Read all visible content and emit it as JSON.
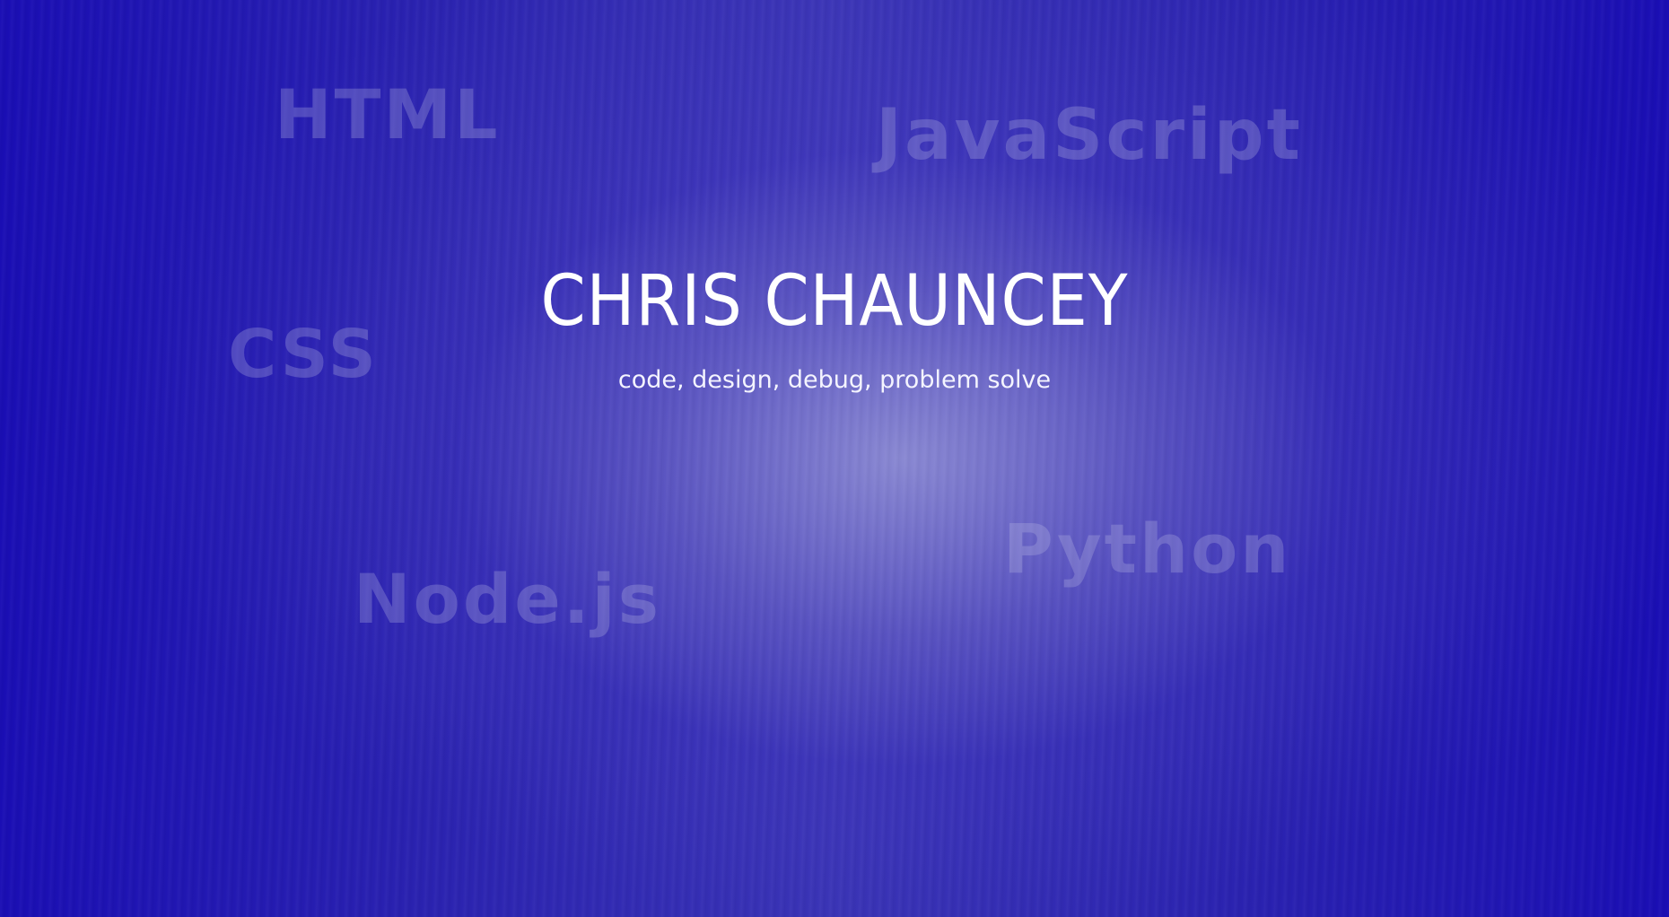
{
  "hero": {
    "name": "CHRIS CHAUNCEY",
    "tagline": "code, design, debug, problem solve"
  },
  "background_words": {
    "html": "HTML",
    "javascript": "JavaScript",
    "css": "CSS",
    "nodejs": "Node.js",
    "python": "Python"
  },
  "colors": {
    "background": "#1a10b0",
    "text": "#ffffff"
  }
}
